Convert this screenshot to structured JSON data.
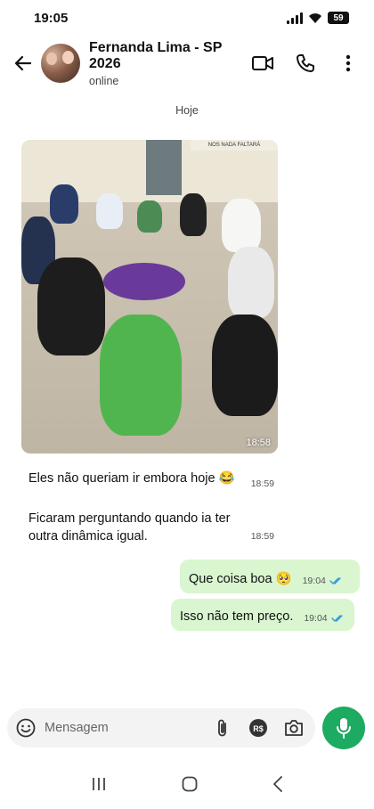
{
  "status_bar": {
    "time": "19:05",
    "battery": "59"
  },
  "header": {
    "contact_name": "Fernanda Lima - SP 2026",
    "contact_status": "online"
  },
  "chat": {
    "date_label": "Hoje",
    "photo": {
      "time": "18:58",
      "sign_text": "NOS NADA FALTARÁ"
    },
    "incoming": [
      {
        "text": "Eles não queriam ir embora hoje 😂",
        "time": "18:59"
      },
      {
        "text_line1": "Ficaram perguntando quando ia ter",
        "text_line2": "outra dinâmica igual.",
        "time": "18:59"
      }
    ],
    "outgoing": [
      {
        "text": "Que coisa boa 🥺",
        "time": "19:04"
      },
      {
        "text": "Isso não tem preço.",
        "time": "19:04"
      }
    ]
  },
  "composer": {
    "placeholder": "Mensagem",
    "icons": [
      "emoji-icon",
      "attach-icon",
      "payment-icon",
      "camera-icon",
      "mic-icon"
    ]
  },
  "colors": {
    "outgoing_bubble": "#d9f6d0",
    "accent_green": "#1daa61",
    "read_ticks": "#3a9bdc"
  }
}
